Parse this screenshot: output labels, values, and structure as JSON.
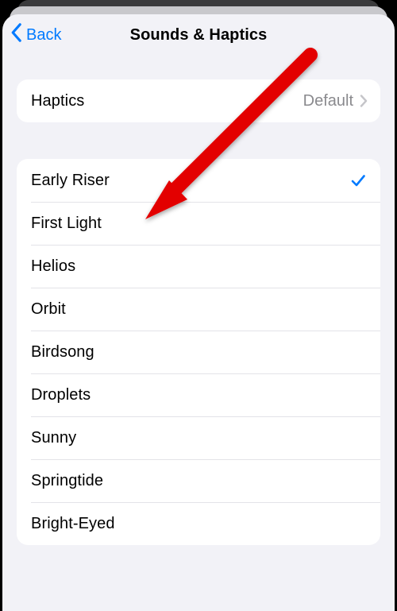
{
  "navbar": {
    "back_label": "Back",
    "title": "Sounds & Haptics"
  },
  "haptics": {
    "label": "Haptics",
    "value": "Default"
  },
  "sounds": [
    {
      "label": "Early Riser",
      "selected": true
    },
    {
      "label": "First Light",
      "selected": false
    },
    {
      "label": "Helios",
      "selected": false
    },
    {
      "label": "Orbit",
      "selected": false
    },
    {
      "label": "Birdsong",
      "selected": false
    },
    {
      "label": "Droplets",
      "selected": false
    },
    {
      "label": "Sunny",
      "selected": false
    },
    {
      "label": "Springtide",
      "selected": false
    },
    {
      "label": "Bright-Eyed",
      "selected": false
    }
  ],
  "colors": {
    "accent": "#007aff",
    "sheet_bg": "#f2f2f7",
    "secondary_text": "#8a8a8e"
  },
  "icons": {
    "back_chevron": "chevron-left-icon",
    "disclosure": "chevron-right-icon",
    "selected": "checkmark-icon",
    "annotation": "arrow-annotation"
  }
}
